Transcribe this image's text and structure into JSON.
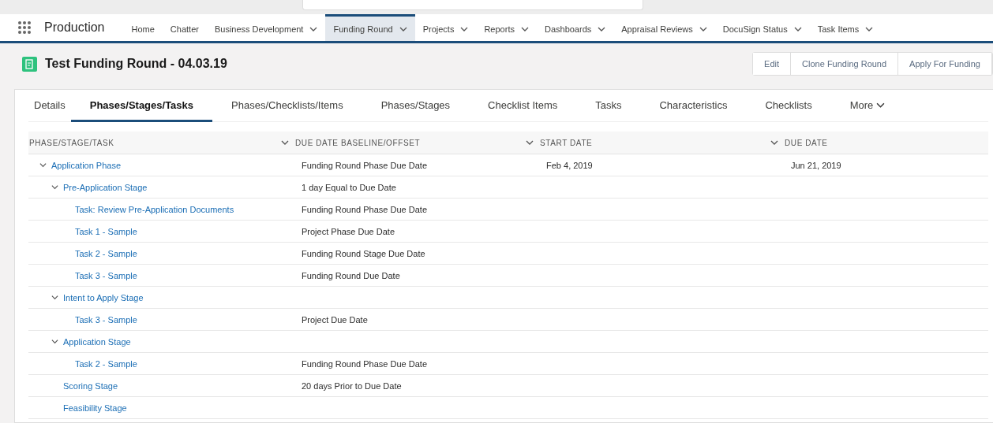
{
  "app": {
    "name": "Production"
  },
  "nav": [
    {
      "label": "Home",
      "has_menu": false,
      "selected": false
    },
    {
      "label": "Chatter",
      "has_menu": false,
      "selected": false
    },
    {
      "label": "Business Development",
      "has_menu": true,
      "selected": false
    },
    {
      "label": "Funding Round",
      "has_menu": true,
      "selected": true
    },
    {
      "label": "Projects",
      "has_menu": true,
      "selected": false
    },
    {
      "label": "Reports",
      "has_menu": true,
      "selected": false
    },
    {
      "label": "Dashboards",
      "has_menu": true,
      "selected": false
    },
    {
      "label": "Appraisal Reviews",
      "has_menu": true,
      "selected": false
    },
    {
      "label": "DocuSign Status",
      "has_menu": true,
      "selected": false
    },
    {
      "label": "Task Items",
      "has_menu": true,
      "selected": false
    }
  ],
  "record": {
    "title": "Test Funding Round - 04.03.19",
    "actions": [
      "Edit",
      "Clone Funding Round",
      "Apply For Funding"
    ]
  },
  "tabs": [
    {
      "label": "Details",
      "selected": false,
      "has_menu": false
    },
    {
      "label": "Phases/Stages/Tasks",
      "selected": true,
      "has_menu": false
    },
    {
      "label": "Phases/Checklists/Items",
      "selected": false,
      "has_menu": false
    },
    {
      "label": "Phases/Stages",
      "selected": false,
      "has_menu": false
    },
    {
      "label": "Checklist Items",
      "selected": false,
      "has_menu": false
    },
    {
      "label": "Tasks",
      "selected": false,
      "has_menu": false
    },
    {
      "label": "Characteristics",
      "selected": false,
      "has_menu": false
    },
    {
      "label": "Checklists",
      "selected": false,
      "has_menu": false
    },
    {
      "label": "More",
      "selected": false,
      "has_menu": true
    }
  ],
  "table": {
    "columns": [
      "PHASE/STAGE/TASK",
      "DUE DATE BASELINE/OFFSET",
      "START DATE",
      "DUE DATE"
    ],
    "rows": [
      {
        "name": "Application Phase",
        "baseline": "Funding Round Phase Due Date",
        "start": "Feb 4, 2019",
        "due": "Jun 21, 2019",
        "expanded": true,
        "children": [
          {
            "name": "Pre-Application Stage",
            "baseline": "1 day Equal to Due Date",
            "expanded": true,
            "children": [
              {
                "name": "Task: Review Pre-Application Documents",
                "baseline": "Funding Round Phase Due Date"
              },
              {
                "name": "Task 1 - Sample",
                "baseline": "Project Phase Due Date"
              },
              {
                "name": "Task 2 - Sample",
                "baseline": "Funding Round Stage Due Date"
              },
              {
                "name": "Task 3 - Sample",
                "baseline": "Funding Round Due Date"
              }
            ]
          },
          {
            "name": "Intent to Apply Stage",
            "expanded": true,
            "children": [
              {
                "name": "Task 3 - Sample",
                "baseline": "Project Due Date"
              }
            ]
          },
          {
            "name": "Application Stage",
            "expanded": true,
            "children": [
              {
                "name": "Task 2 - Sample",
                "baseline": "Funding Round Phase Due Date"
              }
            ]
          },
          {
            "name": "Scoring Stage",
            "baseline": "20 days Prior to Due Date"
          },
          {
            "name": "Feasibility Stage"
          }
        ]
      }
    ]
  }
}
